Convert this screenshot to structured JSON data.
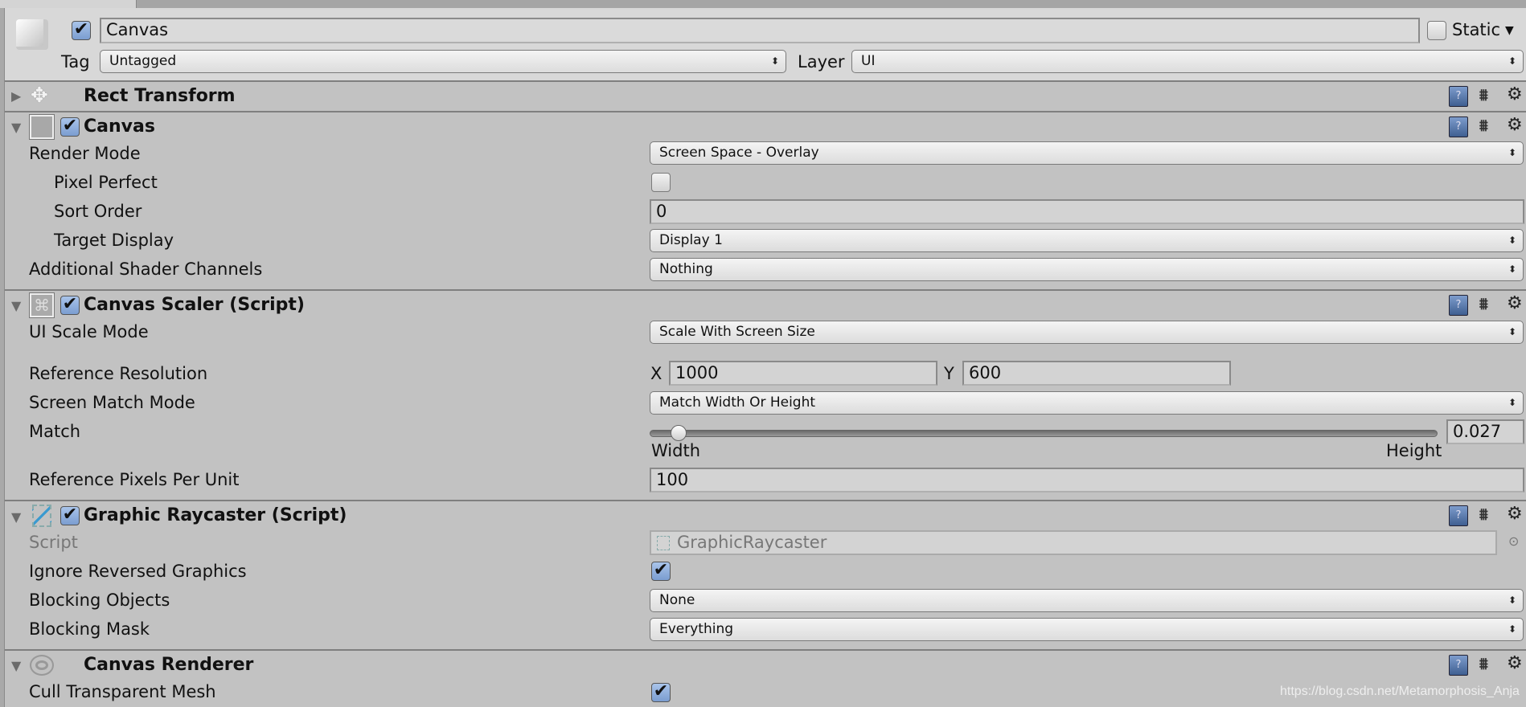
{
  "header": {
    "active": true,
    "name": "Canvas",
    "static_label": "Static",
    "static": false,
    "tag_label": "Tag",
    "tag": "Untagged",
    "layer_label": "Layer",
    "layer": "UI"
  },
  "components": {
    "rect": {
      "title": "Rect Transform"
    },
    "canvas": {
      "title": "Canvas",
      "enabled": true,
      "render_mode_label": "Render Mode",
      "render_mode": "Screen Space - Overlay",
      "pixel_perfect_label": "Pixel Perfect",
      "pixel_perfect": false,
      "sort_order_label": "Sort Order",
      "sort_order": "0",
      "target_display_label": "Target Display",
      "target_display": "Display 1",
      "shader_label": "Additional Shader Channels",
      "shader": "Nothing"
    },
    "scaler": {
      "title": "Canvas Scaler (Script)",
      "enabled": true,
      "ui_scale_label": "UI Scale Mode",
      "ui_scale": "Scale With Screen Size",
      "ref_res_label": "Reference Resolution",
      "x_label": "X",
      "x": "1000",
      "y_label": "Y",
      "y": "600",
      "match_mode_label": "Screen Match Mode",
      "match_mode": "Match Width Or Height",
      "match_label": "Match",
      "match": "0.027",
      "match_value": 0.027,
      "width_label": "Width",
      "height_label": "Height",
      "ppu_label": "Reference Pixels Per Unit",
      "ppu": "100"
    },
    "raycaster": {
      "title": "Graphic Raycaster (Script)",
      "enabled": true,
      "script_label": "Script",
      "script": "GraphicRaycaster",
      "ignore_label": "Ignore Reversed Graphics",
      "ignore": true,
      "blocking_objects_label": "Blocking Objects",
      "blocking_objects": "None",
      "blocking_mask_label": "Blocking Mask",
      "blocking_mask": "Everything"
    },
    "renderer": {
      "title": "Canvas Renderer",
      "cull_label": "Cull Transparent Mesh",
      "cull": true
    }
  },
  "icons": {
    "help": "?",
    "checkmark": "✔",
    "fold_open": "▼",
    "fold_closed": "▶",
    "gear": "⚙",
    "dropdown": "⬍"
  },
  "watermark": "https://blog.csdn.net/Metamorphosis_Anja",
  "colors": {
    "panel": "#c2c2c2",
    "header": "#d8d8d8",
    "check": "#7b9dd0"
  }
}
